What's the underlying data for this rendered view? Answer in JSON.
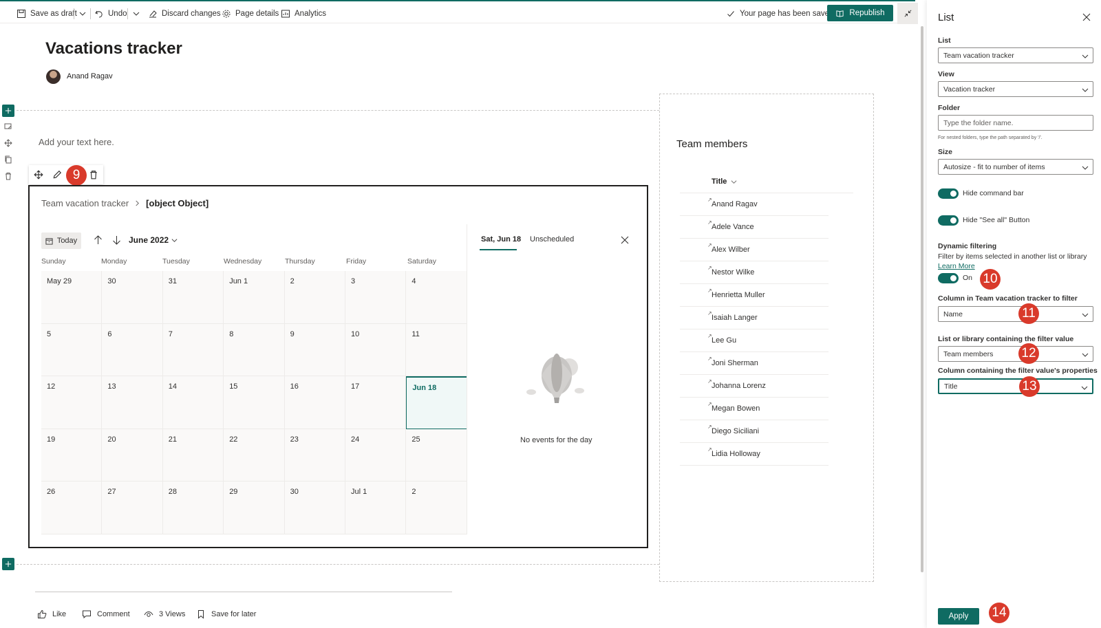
{
  "toolbar": {
    "save_draft": "Save as draft",
    "undo": "Undo",
    "discard": "Discard changes",
    "page_details": "Page details",
    "analytics": "Analytics",
    "saved_status": "Your page has been saved",
    "republish": "Republish"
  },
  "page": {
    "title": "Vacations tracker",
    "author": "Anand Ragav",
    "text_placeholder": "Add your text here."
  },
  "calendar": {
    "breadcrumb_list": "Team vacation tracker",
    "breadcrumb_view": "[object Object]",
    "today": "Today",
    "month": "June 2022",
    "days": [
      "Sunday",
      "Monday",
      "Tuesday",
      "Wednesday",
      "Thursday",
      "Friday",
      "Saturday"
    ],
    "weeks": [
      [
        "May 29",
        "30",
        "31",
        "Jun 1",
        "2",
        "3",
        "4"
      ],
      [
        "5",
        "6",
        "7",
        "8",
        "9",
        "10",
        "11"
      ],
      [
        "12",
        "13",
        "14",
        "15",
        "16",
        "17",
        "Jun 18"
      ],
      [
        "19",
        "20",
        "21",
        "22",
        "23",
        "24",
        "25"
      ],
      [
        "26",
        "27",
        "28",
        "29",
        "30",
        "Jul 1",
        "2"
      ]
    ],
    "selected_date": "Jun 18",
    "tab_day": "Sat, Jun 18",
    "tab_unscheduled": "Unscheduled",
    "no_events": "No events for the day"
  },
  "team_members": {
    "title": "Team members",
    "column": "Title",
    "rows": [
      "Anand Ragav",
      "Adele Vance",
      "Alex Wilber",
      "Nestor Wilke",
      "Henrietta Muller",
      "Isaiah Langer",
      "Lee Gu",
      "Joni Sherman",
      "Johanna Lorenz",
      "Megan Bowen",
      "Diego Siciliani",
      "Lidia Holloway"
    ]
  },
  "footer": {
    "like": "Like",
    "comment": "Comment",
    "views": "3 Views",
    "save_later": "Save for later"
  },
  "pane": {
    "title": "List",
    "list_label": "List",
    "list_value": "Team vacation tracker",
    "view_label": "View",
    "view_value": "Vacation tracker",
    "folder_label": "Folder",
    "folder_placeholder": "Type the folder name.",
    "folder_hint": "For nested folders, type the path separated by '/'.",
    "size_label": "Size",
    "size_value": "Autosize - fit to number of items",
    "hide_cmd": "Hide command bar",
    "hide_see_all": "Hide \"See all\" Button",
    "dyn_label": "Dynamic filtering",
    "dyn_desc": "Filter by items selected in another list or library",
    "learn_more": "Learn More",
    "dyn_state": "On",
    "col_filter_label": "Column in Team vacation tracker to filter",
    "col_filter_value": "Name",
    "list_filter_label": "List or library containing the filter value",
    "list_filter_value": "Team members",
    "prop_label": "Column containing the filter value's properties",
    "prop_value": "Title",
    "apply": "Apply"
  },
  "badges": [
    "9",
    "10",
    "11",
    "12",
    "13",
    "14"
  ],
  "colors": {
    "accent": "#0f6b62",
    "badge": "#d93a2b"
  }
}
